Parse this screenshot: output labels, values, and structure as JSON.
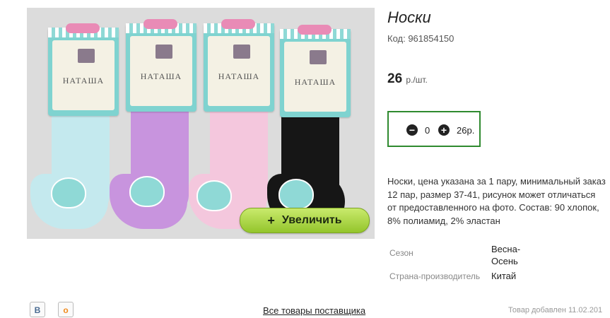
{
  "product": {
    "title": "Носки",
    "code": "Код: 961854150",
    "price_value": "26",
    "price_unit": "р./шт.",
    "description": "Носки, цена указана за 1 пару, минимальный заказ 12 пар, размер 37-41, рисунок может отличаться от предоставленного на фото. Состав: 90 хлопок, 8% полиамид, 2% эластан"
  },
  "cart": {
    "minus_icon": "minus-circle-icon",
    "plus_icon": "plus-circle-icon",
    "quantity": "0",
    "sum": "26р."
  },
  "image": {
    "zoom_label": "Увеличить",
    "zoom_plus": "+",
    "card_brand": "НАТАША",
    "sock_colors": [
      "#bfe6ec",
      "#c893df",
      "#f3c4dc",
      "#151515"
    ]
  },
  "properties": [
    {
      "label": "Сезон",
      "value": "Весна-\nОсень"
    },
    {
      "label": "Страна-производитель",
      "value": "Китай"
    }
  ],
  "footer": {
    "vk_label": "В",
    "ok_label": "о",
    "all_goods": "Все товары поставщика",
    "added": "Товар добавлен 11.02.201"
  }
}
